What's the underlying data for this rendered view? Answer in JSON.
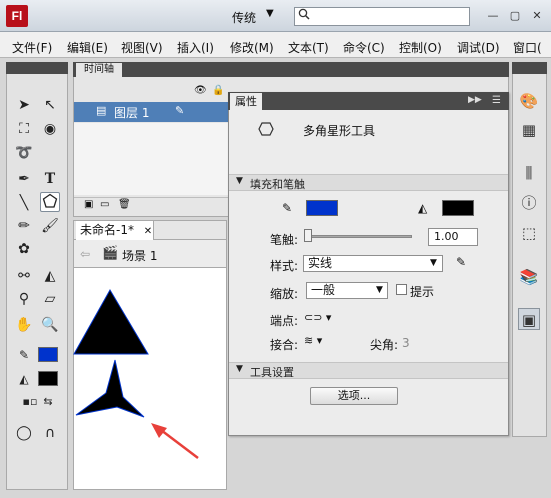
{
  "app": {
    "logo": "Fl",
    "workspace": "传统",
    "window_controls": [
      "minimize",
      "restore",
      "close"
    ]
  },
  "menu": [
    "文件(F)",
    "编辑(E)",
    "视图(V)",
    "插入(I)",
    "修改(M)",
    "文本(T)",
    "命令(C)",
    "控制(O)",
    "调试(D)",
    "窗口("
  ],
  "timeline": {
    "tab_label": "时间轴",
    "layer_name": "图层 1"
  },
  "document": {
    "tab_label": "未命名-1*",
    "scene_label": "场景 1"
  },
  "properties": {
    "tab_label": "属性",
    "tool_name": "多角星形工具",
    "fill_stroke_section": "填充和笔触",
    "stroke_color": "#0033cc",
    "fill_color": "#000000",
    "stroke_label": "笔触:",
    "stroke_value": "1.00",
    "style_label": "样式:",
    "style_value": "实线",
    "scale_label": "缩放:",
    "scale_value": "一般",
    "hinting_label": "提示",
    "cap_label": "端点:",
    "join_label": "接合:",
    "miter_label": "尖角:",
    "miter_value": "3",
    "tool_settings_section": "工具设置",
    "options_button": "选项..."
  },
  "toolbar": {
    "stroke_color": "#0033cc",
    "fill_color": "#000000"
  },
  "stage": {
    "triangle_fill": "#000000",
    "triangle_stroke": "#0033cc",
    "arrow_color": "#e8403a"
  },
  "icons": [
    "search-icon",
    "eye-icon",
    "lock-icon",
    "pencil-icon",
    "polygon-icon",
    "paint-bucket-icon",
    "gear-icon",
    "info-icon"
  ]
}
